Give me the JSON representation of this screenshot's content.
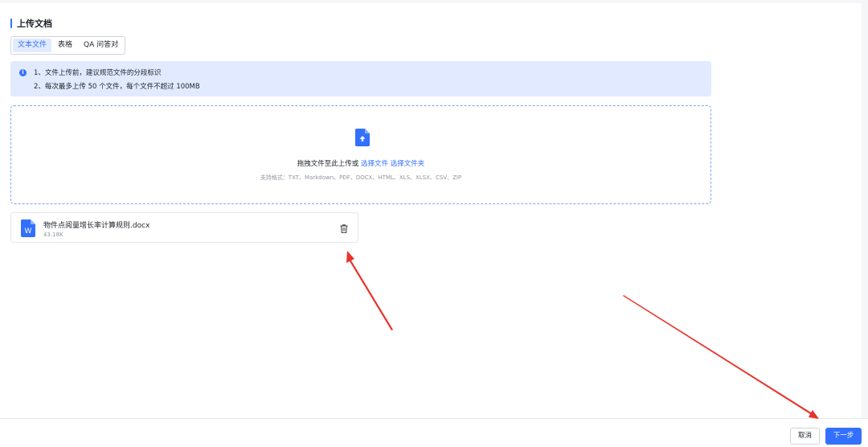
{
  "section": {
    "title": "上传文档"
  },
  "tabs": [
    {
      "label": "文本文件",
      "active": true
    },
    {
      "label": "表格",
      "active": false
    },
    {
      "label": "QA 问答对",
      "active": false
    }
  ],
  "notice": {
    "icon": "info-icon",
    "lines": [
      "1、文件上传前，建议规范文件的分段标识",
      "2、每次最多上传 50 个文件，每个文件不超过 100MB"
    ]
  },
  "dropzone": {
    "icon": "upload-file-icon",
    "prompt": "拖拽文件至此上传或",
    "select_file": "选择文件",
    "select_folder": "选择文件夹",
    "formats": "支持格式：TXT、Markdown、PDF、DOCX、HTML、XLS、XLSX、CSV、ZIP"
  },
  "files": [
    {
      "icon": "word-file-icon",
      "name": "物件点阅量增长率计算规则.docx",
      "size": "43.18K"
    }
  ],
  "footer": {
    "cancel_label": "取消",
    "next_label": "下一步"
  },
  "colors": {
    "accent": "#3370ff",
    "notice_bg": "#e1eaff",
    "annotation_arrow": "#e8332a"
  }
}
